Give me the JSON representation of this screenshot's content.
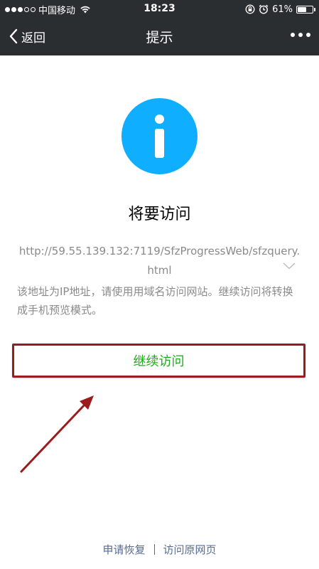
{
  "status_bar": {
    "carrier": "中国移动",
    "time": "18:23",
    "battery_percent": "61%",
    "battery_level": 0.61,
    "signal_filled": 3,
    "signal_total": 5
  },
  "nav": {
    "back_label": "返回",
    "title": "提示"
  },
  "content": {
    "heading": "将要访问",
    "url": "http://59.55.139.132:7119/SfzProgressWeb/sfzquery.html",
    "notice": "该地址为IP地址，请使用用域名访问网站。继续访问将转换成手机预览模式。",
    "continue_label": "继续访问"
  },
  "footer": {
    "restore_label": "申请恢复",
    "original_label": "访问原网页"
  },
  "colors": {
    "nav_background": "#2b2e31",
    "info_icon": "#10aeff",
    "continue_text": "#1aad19",
    "link": "#576b95",
    "annotation": "#9b1c1c"
  }
}
